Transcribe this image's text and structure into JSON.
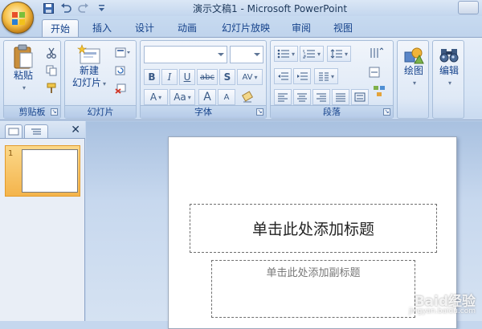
{
  "window": {
    "title": "演示文稿1 - Microsoft PowerPoint"
  },
  "tabs": [
    {
      "label": "开始",
      "active": true
    },
    {
      "label": "插入"
    },
    {
      "label": "设计"
    },
    {
      "label": "动画"
    },
    {
      "label": "幻灯片放映"
    },
    {
      "label": "审阅"
    },
    {
      "label": "视图"
    }
  ],
  "ribbon": {
    "clipboard": {
      "group_label": "剪贴板",
      "paste_label": "粘贴"
    },
    "slides": {
      "group_label": "幻灯片",
      "new_slide_line1": "新建",
      "new_slide_line2": "幻灯片"
    },
    "font": {
      "group_label": "字体",
      "font_name": "",
      "font_size": "",
      "bold": "B",
      "italic": "I",
      "underline": "U",
      "strikethrough": "abc",
      "shadow": "S",
      "spacing": "AV",
      "color": "A",
      "case": "Aa",
      "grow": "A",
      "shrink": "A"
    },
    "paragraph": {
      "group_label": "段落"
    },
    "drawing": {
      "label": "绘图"
    },
    "editing": {
      "label": "编辑"
    }
  },
  "slide_pane": {
    "close_label": "✕",
    "slide_number": "1"
  },
  "slide": {
    "title_placeholder": "单击此处添加标题",
    "subtitle_placeholder": "单击此处添加副标题"
  },
  "watermark": {
    "main": "Baid经验",
    "sub": "jingyan.baidu.com"
  },
  "colors": {
    "accent": "#15428b",
    "ribbon": "#dfe9f6",
    "selected_thumb": "#f4b44c"
  }
}
